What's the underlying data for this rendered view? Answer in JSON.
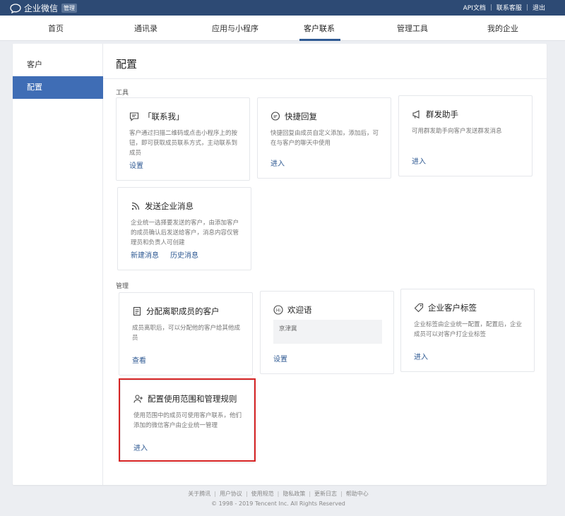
{
  "app": {
    "name": "企业微信",
    "badge": "管理"
  },
  "top_links": [
    "API文档",
    "联系客服",
    "退出"
  ],
  "nav": [
    {
      "label": "首页",
      "active": false
    },
    {
      "label": "通讯录",
      "active": false
    },
    {
      "label": "应用与小程序",
      "active": false
    },
    {
      "label": "客户联系",
      "active": true
    },
    {
      "label": "管理工具",
      "active": false
    },
    {
      "label": "我的企业",
      "active": false
    }
  ],
  "sidebar": {
    "items": [
      {
        "label": "客户",
        "active": false
      },
      {
        "label": "配置",
        "active": true
      }
    ]
  },
  "content": {
    "title": "配置",
    "tools_label": "工具",
    "manage_label": "管理",
    "cards": {
      "contact_me": {
        "title": "「联系我」",
        "desc": "客户通过扫描二维码或点击小程序上的按钮，即可获取成员联系方式，主动联系到成员",
        "actions": [
          "设置"
        ]
      },
      "quick_reply": {
        "title": "快捷回复",
        "desc": "快捷回复由成员自定义添加，添加后，可在与客户的聊天中使用",
        "actions": [
          "进入"
        ]
      },
      "group_send": {
        "title": "群发助手",
        "desc": "可用群发助手向客户发送群发消息",
        "actions": [
          "进入"
        ]
      },
      "enterprise_msg": {
        "title": "发送企业消息",
        "desc": "企业统一选择要发送的客户，由添加客户的成员确认后发送给客户，消息内容仅管理员和负责人可创建",
        "actions": [
          "新建消息",
          "历史消息"
        ]
      },
      "assign_resigned": {
        "title": "分配离职成员的客户",
        "desc": "成员离职后，可以分配他的客户给其他成员",
        "actions": [
          "查看"
        ]
      },
      "welcome": {
        "title": "欢迎语",
        "box_text": "京津冀",
        "actions": [
          "设置"
        ]
      },
      "tags": {
        "title": "企业客户标签",
        "desc": "企业标签由企业统一配置，配置后，企业成员可以对客户打企业标签",
        "actions": [
          "进入"
        ]
      },
      "scope_rules": {
        "title": "配置使用范围和管理规则",
        "desc": "使用范围中的成员可使用客户联系，他们添加的微信客户由企业统一管理",
        "actions": [
          "进入"
        ]
      }
    }
  },
  "footer": {
    "links": [
      "关于腾讯",
      "用户协议",
      "使用规范",
      "隐私政策",
      "更新日志",
      "帮助中心"
    ],
    "copyright": "© 1998 - 2019 Tencent Inc. All Rights Reserved"
  },
  "colors": {
    "topbar": "#2d4a74",
    "accent": "#3f6db5",
    "link": "#2f5a93",
    "highlight": "#d62424"
  }
}
